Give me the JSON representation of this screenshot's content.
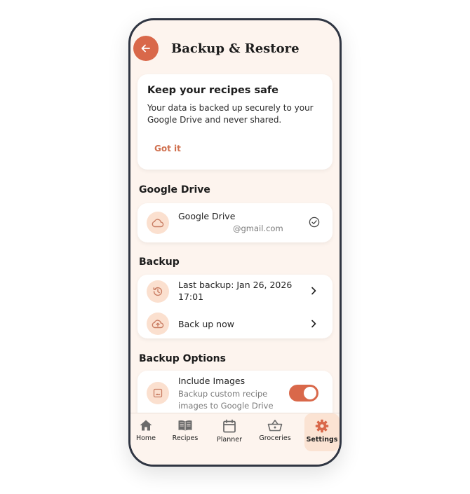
{
  "header": {
    "title": "Backup & Restore",
    "back_icon": "arrow-left-icon"
  },
  "info_card": {
    "title": "Keep your recipes safe",
    "text": "Your data is backed up securely to your Google Drive and never shared.",
    "action": "Got it"
  },
  "sections": {
    "google_drive": "Google Drive",
    "backup": "Backup",
    "backup_options": "Backup Options"
  },
  "drive": {
    "label": "Google Drive",
    "account": "@gmail.com",
    "icon": "cloud-icon",
    "status_icon": "check-circle-icon"
  },
  "backup": {
    "last_backup": "Last backup: Jan 26, 2026 17:01",
    "back_up_now": "Back up now"
  },
  "options": {
    "include_images_label": "Include Images",
    "include_images_desc": "Backup custom recipe images to Google Drive",
    "include_images_enabled": true
  },
  "nav": {
    "items": [
      {
        "label": "Home",
        "icon": "home-icon"
      },
      {
        "label": "Recipes",
        "icon": "book-icon"
      },
      {
        "label": "Planner",
        "icon": "calendar-icon"
      },
      {
        "label": "Groceries",
        "icon": "basket-icon"
      },
      {
        "label": "Settings",
        "icon": "gear-icon",
        "active": true
      }
    ]
  },
  "colors": {
    "accent": "#d9684a",
    "background": "#fdf4ee",
    "icon_circle": "#fbe0cf",
    "frame": "#2f3542"
  }
}
